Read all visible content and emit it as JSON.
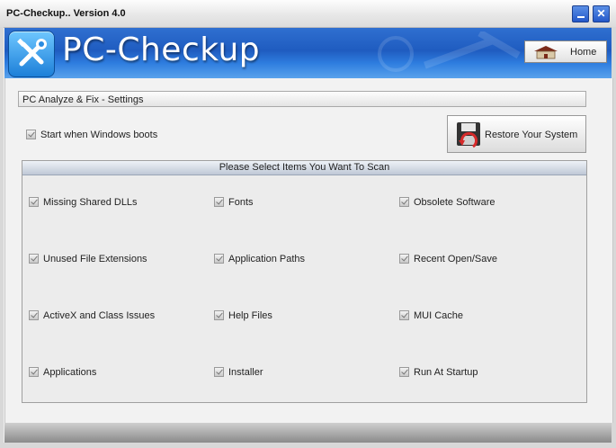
{
  "window": {
    "title": "PC-Checkup..  Version 4.0"
  },
  "header": {
    "app_name": "PC-Checkup",
    "home_label": "Home"
  },
  "settings": {
    "section_title": "PC Analyze & Fix - Settings",
    "start_boot_label": "Start when Windows boots",
    "start_boot_checked": true,
    "restore_label": "Restore Your System"
  },
  "scan": {
    "header": "Please Select Items You Want To Scan",
    "items": [
      {
        "label": "Missing Shared DLLs",
        "checked": true
      },
      {
        "label": "Fonts",
        "checked": true
      },
      {
        "label": "Obsolete Software",
        "checked": true
      },
      {
        "label": "Unused File Extensions",
        "checked": true
      },
      {
        "label": "Application Paths",
        "checked": true
      },
      {
        "label": "Recent Open/Save",
        "checked": true
      },
      {
        "label": "ActiveX and Class Issues",
        "checked": true
      },
      {
        "label": "Help Files",
        "checked": true
      },
      {
        "label": "MUI Cache",
        "checked": true
      },
      {
        "label": "Applications",
        "checked": true
      },
      {
        "label": "Installer",
        "checked": true
      },
      {
        "label": "Run At Startup",
        "checked": true
      }
    ]
  },
  "icons": {
    "minimize": "minimize-icon",
    "close": "close-icon",
    "logo": "wrench-screwdriver-icon",
    "home": "house-icon",
    "restore": "floppy-restore-icon"
  },
  "colors": {
    "header_blue": "#1f5cc0",
    "titlebar_button": "#2458c9"
  }
}
